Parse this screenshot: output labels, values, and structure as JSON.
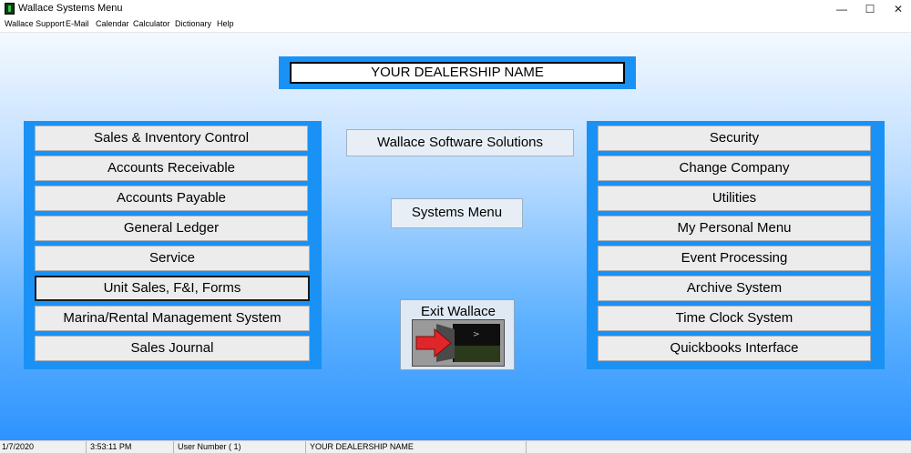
{
  "window": {
    "title": "Wallace Systems Menu",
    "minimize": "—",
    "maximize": "☐",
    "close": "✕"
  },
  "menu": [
    "Wallace Support",
    "E-Mail",
    "Calendar",
    "Calculator",
    "Dictionary",
    "Help"
  ],
  "dealership_name": "YOUR DEALERSHIP NAME",
  "left_buttons": [
    "Sales & Inventory Control",
    "Accounts Receivable",
    "Accounts Payable",
    "General Ledger",
    "Service",
    "Unit Sales, F&I, Forms",
    "Marina/Rental Management System",
    "Sales Journal"
  ],
  "center": {
    "company_label": "Wallace Software Solutions",
    "menu_label": "Systems Menu",
    "exit_label": "Exit Wallace"
  },
  "right_buttons": [
    "Security",
    "Change Company",
    "Utilities",
    "My Personal Menu",
    "Event Processing",
    "Archive System",
    "Time Clock System",
    "Quickbooks Interface"
  ],
  "status": {
    "date": "1/7/2020",
    "time": "3:53:11 PM",
    "user": "User Number ( 1)",
    "dealership": "YOUR DEALERSHIP NAME"
  },
  "colors": {
    "panel_blue": "#1a92f5",
    "button_face": "#ececec",
    "exit_arrow": "#e0262a"
  }
}
